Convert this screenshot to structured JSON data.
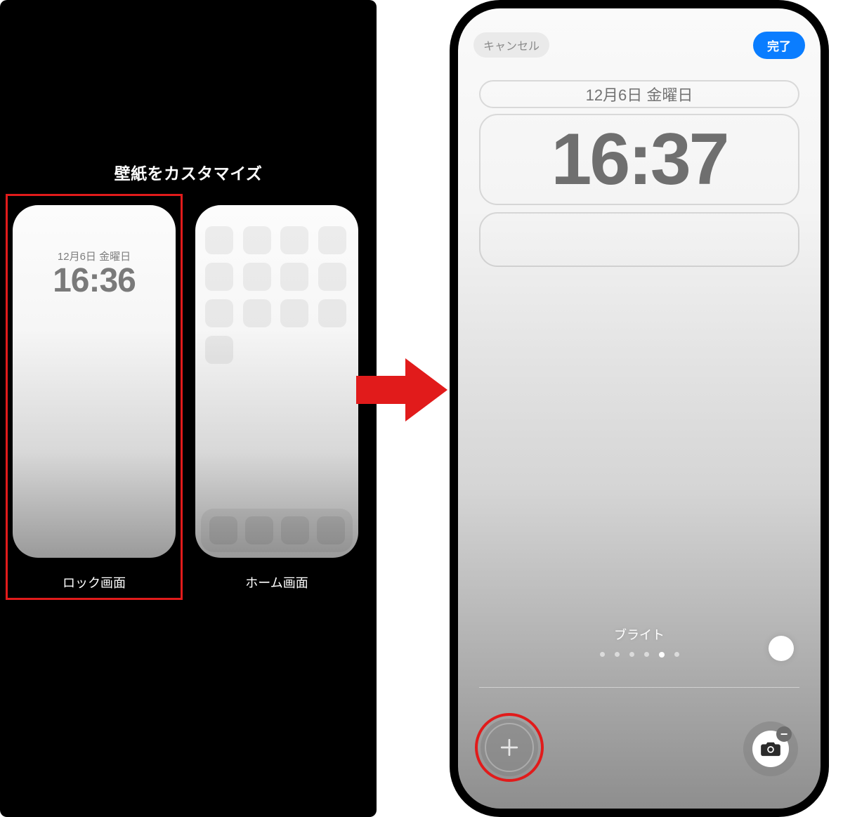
{
  "left": {
    "title": "壁紙をカスタマイズ",
    "lock_thumb": {
      "date": "12月6日 金曜日",
      "time": "16:36",
      "caption": "ロック画面"
    },
    "home_thumb": {
      "caption": "ホーム画面"
    }
  },
  "right": {
    "cancel_label": "キャンセル",
    "done_label": "完了",
    "date": "12月6日 金曜日",
    "time": "16:37",
    "style_label": "ブライト",
    "page_dot_count": 6,
    "page_dot_active_index": 4
  },
  "colors": {
    "highlight": "#e11b1b",
    "accent": "#0a7dff"
  }
}
